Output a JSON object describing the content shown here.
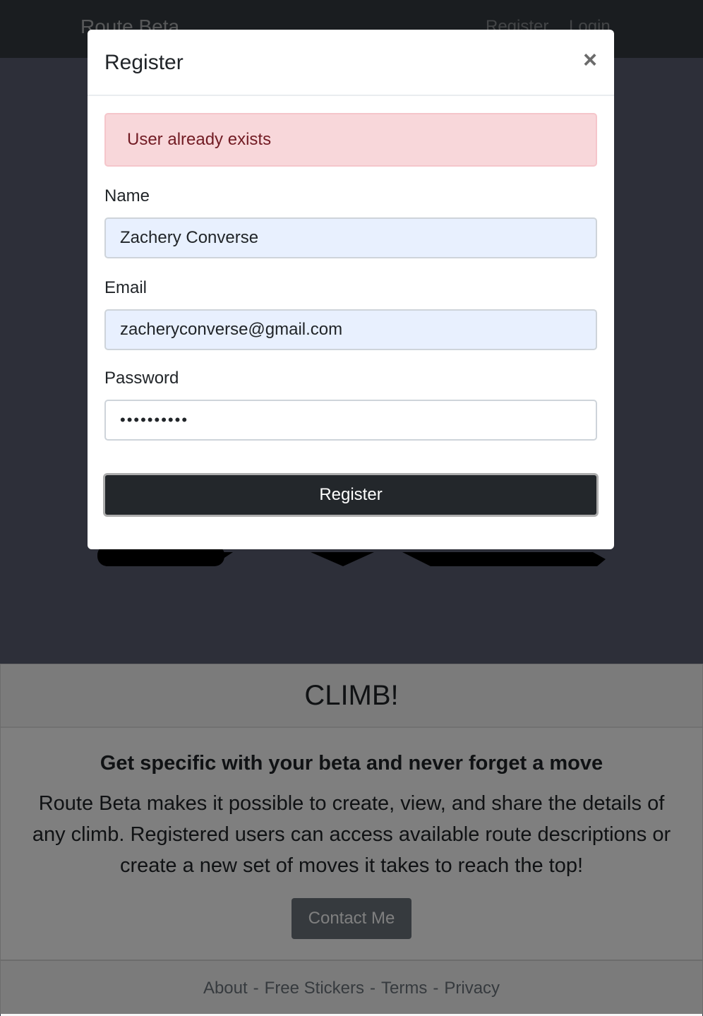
{
  "navbar": {
    "brand": "Route Beta",
    "links": [
      "Register",
      "Login"
    ]
  },
  "card": {
    "header": "CLIMB!",
    "subtitle": "Get specific with your beta and never forget a move",
    "text": "Route Beta makes it possible to create, view, and share the details of any climb. Registered users can access available route descriptions or create a new set of moves it takes to reach the top!",
    "button": "Contact Me",
    "footer_links": [
      "About",
      "Free Stickers",
      "Terms",
      "Privacy"
    ],
    "footer_separator": "-"
  },
  "modal": {
    "title": "Register",
    "close_label": "×",
    "alert": "User already exists",
    "fields": {
      "name": {
        "label": "Name",
        "value": "Zachery Converse"
      },
      "email": {
        "label": "Email",
        "value": "zacheryconverse@gmail.com"
      },
      "password": {
        "label": "Password",
        "value": "••••••••••"
      }
    },
    "submit_label": "Register"
  },
  "colors": {
    "backdrop": "rgba(0,0,0,0.5)",
    "alert_bg": "#f8d7da",
    "alert_text": "#721c24",
    "autofill_bg": "#e8f0fe",
    "dark_button": "#23272b"
  }
}
